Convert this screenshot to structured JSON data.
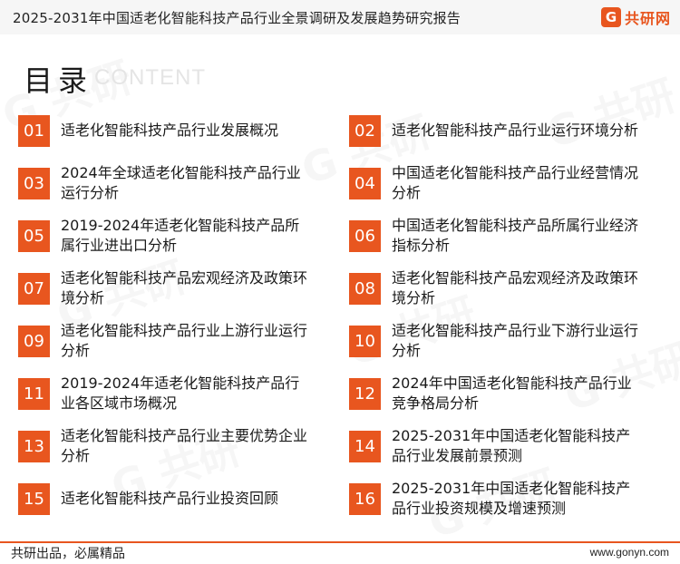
{
  "header": {
    "title": "2025-2031年中国适老化智能科技产品行业全景调研及发展趋势研究报告",
    "logo_mark": "G",
    "logo_text": "共研网"
  },
  "section": {
    "title": "目录",
    "subtitle": "CONTENT"
  },
  "toc": [
    {
      "num": "01",
      "text": "适老化智能科技产品行业发展概况"
    },
    {
      "num": "02",
      "text": "适老化智能科技产品行业运行环境分析"
    },
    {
      "num": "03",
      "text": "2024年全球适老化智能科技产品行业运行分析"
    },
    {
      "num": "04",
      "text": "中国适老化智能科技产品行业经营情况分析"
    },
    {
      "num": "05",
      "text": "2019-2024年适老化智能科技产品所属行业进出口分析"
    },
    {
      "num": "06",
      "text": "中国适老化智能科技产品所属行业经济指标分析"
    },
    {
      "num": "07",
      "text": "适老化智能科技产品宏观经济及政策环境分析"
    },
    {
      "num": "08",
      "text": "适老化智能科技产品宏观经济及政策环境分析"
    },
    {
      "num": "09",
      "text": "适老化智能科技产品行业上游行业运行分析"
    },
    {
      "num": "10",
      "text": "适老化智能科技产品行业下游行业运行分析"
    },
    {
      "num": "11",
      "text": "2019-2024年适老化智能科技产品行业各区域市场概况"
    },
    {
      "num": "12",
      "text": "2024年中国适老化智能科技产品行业竞争格局分析"
    },
    {
      "num": "13",
      "text": "适老化智能科技产品行业主要优势企业分析"
    },
    {
      "num": "14",
      "text": "2025-2031年中国适老化智能科技产品行业发展前景预测"
    },
    {
      "num": "15",
      "text": "适老化智能科技产品行业投资回顾"
    },
    {
      "num": "16",
      "text": "2025-2031年中国适老化智能科技产品行业投资规模及增速预测"
    }
  ],
  "footer": {
    "slogan": "共研出品，必属精品",
    "url": "www.gonyn.com"
  },
  "colors": {
    "accent": "#e8561f"
  }
}
